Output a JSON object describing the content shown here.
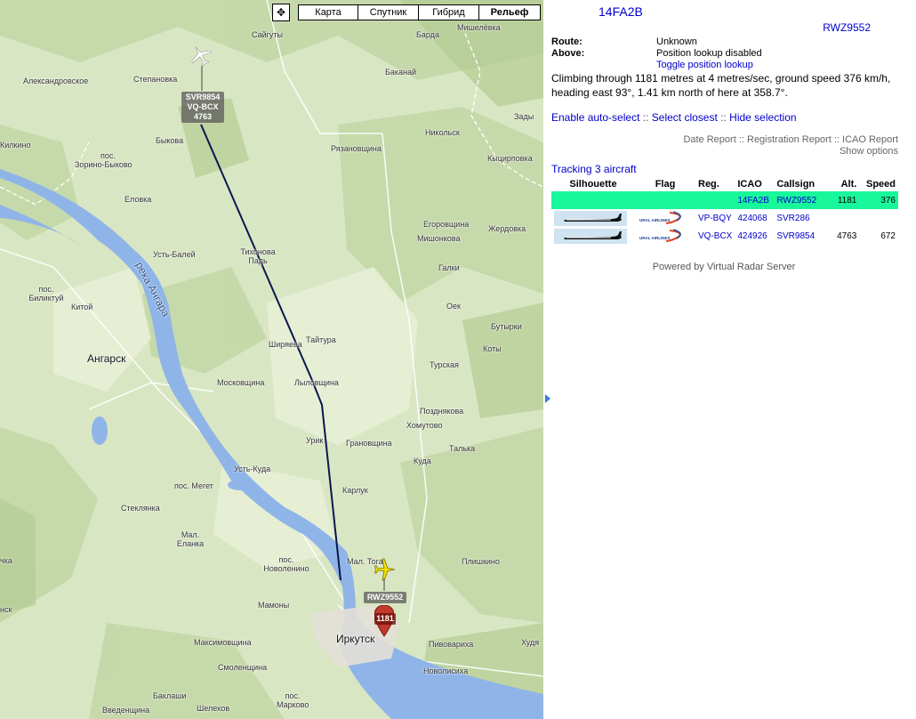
{
  "map": {
    "pan_symbol": "✥",
    "maptypes": [
      {
        "label": "Карта",
        "active": false
      },
      {
        "label": "Спутник",
        "active": false
      },
      {
        "label": "Гибрид",
        "active": false
      },
      {
        "label": "Рельеф",
        "active": true
      }
    ],
    "places": {
      "saigaty": "Сайгуты",
      "barda": "Барда",
      "misheleevka": "Мишелёвка",
      "stepanovka": "Степановка",
      "aleksandrovskoe": "Александровское",
      "bakanai": "Баканай",
      "zady": "Зады",
      "kilkino": "Килкино",
      "bykova": "Быкова",
      "pos": "пос.",
      "zorino": "Зорино-Быково",
      "nikolsk": "Никольск",
      "ryazanovshchina": "Рязановщина",
      "kycirpovka": "Кыцирповка",
      "elovka": "Еловка",
      "egorovshchina": "Егоровщина",
      "mishonkova": "Мишонкова",
      "zherdovka": "Жердовка",
      "ust_balei": "Усть-Балей",
      "tikhonova_pad": "Тихонова Падь",
      "galki": "Галки",
      "pos_biliktui": "пос. Биликтуй",
      "kitoi": "Китой",
      "oek": "Оек",
      "angarsk": "Ангарск",
      "shiryaeva": "Ширяева",
      "taitura": "Тайтура",
      "butyrki": "Бутырки",
      "koty": "Коты",
      "turskaya": "Турская",
      "moskovshchina": "Московщина",
      "lylovshchina": "Лыловщина",
      "pozdnyakova": "Позднякова",
      "khomutovo": "Хомутово",
      "urik": "Урик",
      "granovshchina": "Грановщина",
      "talka": "Талька",
      "kuda": "Куда",
      "ust_kuda": "Усть-Куда",
      "pos_meget": "пос. Мегет",
      "karluk": "Карлук",
      "steklyanka": "Стеклянка",
      "mal_elanka": "Мал. Еланка",
      "pos_novolenino": "пос. Новоленино",
      "mal_toga": "Мал. Тога",
      "plishkino": "Плишкино",
      "chka": "чка",
      "mamony": "Мамоны",
      "irkutsk": "Иркутск",
      "pivovaricha": "Пивовариха",
      "maksimovshchina": "Максимовщина",
      "khuda": "Худя",
      "novolisikha": "Новолисиха",
      "smolenshchina": "Смоленщина",
      "baklashi": "Баклаши",
      "vvedenshchina": "Введенщина",
      "shelekhov": "Шелехов",
      "pos_markovo": "пос. Марково",
      "nsk": "нск",
      "reka_angara": "река Ангара"
    },
    "aircraft_labels": {
      "svr9854": [
        "SVR9854",
        "VQ-BCX",
        "4763"
      ],
      "rwz9552": [
        "RWZ9552",
        "1181"
      ]
    },
    "colors": {
      "terrain": "#d9e6c3",
      "river": "#8fb5e8",
      "track": "#0a1750",
      "selected_plane": "#f5e400"
    }
  },
  "panel": {
    "icao": "14FA2B",
    "callsign": "RWZ9552",
    "route_label": "Route:",
    "route_value": "Unknown",
    "above_label": "Above:",
    "above_value": "Position lookup disabled",
    "toggle_lookup": "Toggle position lookup",
    "description": "Climbing through 1181 metres at 4 metres/sec, ground speed 376 km/h, heading east 93°, 1.41 km north of here at 358.7°.",
    "actions": {
      "enable_autoselect": "Enable auto-select",
      "select_closest": "Select closest",
      "hide_selection": "Hide selection",
      "separator": "::"
    },
    "reports": {
      "date": "Date Report",
      "registration": "Registration Report",
      "icao": "ICAO Report",
      "separator": "::",
      "show_options": "Show options"
    },
    "tracking": "Tracking 3 aircraft",
    "columns": [
      "Silhouette",
      "Flag",
      "Reg.",
      "ICAO",
      "Callsign",
      "Alt.",
      "Speed"
    ],
    "rows": [
      {
        "reg": "",
        "icao": "14FA2B",
        "callsign": "RWZ9552",
        "alt": "1181",
        "speed": "376"
      },
      {
        "reg": "VP-BQY",
        "icao": "424068",
        "callsign": "SVR286",
        "alt": "",
        "speed": ""
      },
      {
        "reg": "VQ-BCX",
        "icao": "424926",
        "callsign": "SVR9854",
        "alt": "4763",
        "speed": "672"
      }
    ],
    "flag_text": "URAL AIRLINES",
    "powered": "Powered by Virtual Radar Server"
  }
}
